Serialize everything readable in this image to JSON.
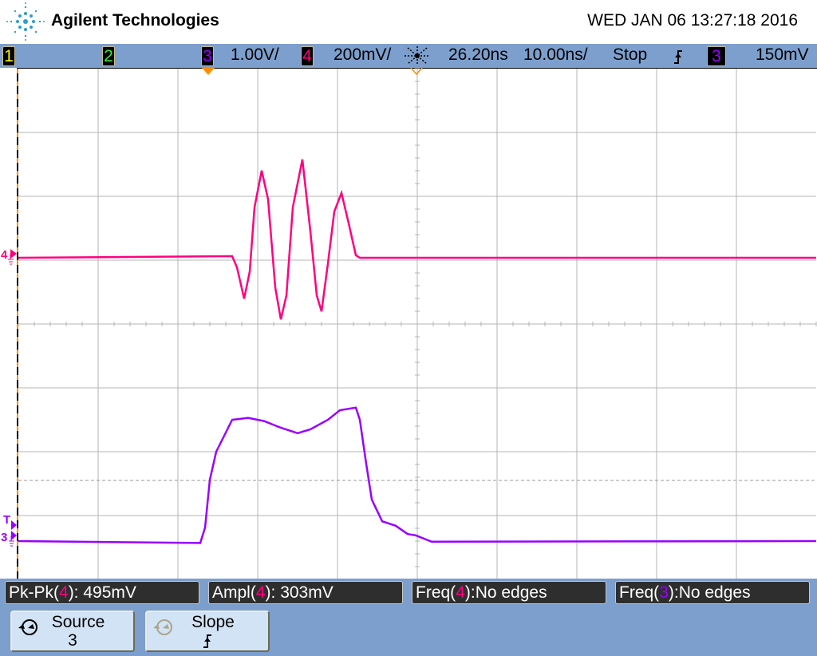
{
  "header": {
    "brand": "Agilent Technologies",
    "datetime": "WED JAN 06 13:27:18 2016"
  },
  "topbar": {
    "channels": [
      {
        "num": "1",
        "color": "#f5f500"
      },
      {
        "num": "2",
        "color": "#33ee33"
      },
      {
        "num": "3",
        "color": "#9900ff",
        "scale": "1.00V/"
      },
      {
        "num": "4",
        "color": "#ff0080",
        "scale": "200mV/"
      }
    ],
    "time_delay": "26.20ns",
    "time_scale": "10.00ns/",
    "run_state": "Stop",
    "trigger_slope_icon": "rising-edge-icon",
    "trigger_source": "3",
    "trigger_level": "150mV"
  },
  "display": {
    "time_per_div_ns": 10,
    "time_center_ns": 26.2,
    "colors": {
      "grid": "#b4b4b4",
      "ch3": "#9900ff",
      "ch4": "#ff0080",
      "marker": "#ff8c00"
    },
    "ch4_markers": {
      "label": "4"
    },
    "ch3_markers": {
      "label": "3",
      "trigger_label": "T"
    },
    "waveforms": {
      "ch4": {
        "units": "mV",
        "per_div": 200,
        "points": [
          [
            -23.8,
            0
          ],
          [
            3.0,
            5
          ],
          [
            3.6,
            -30
          ],
          [
            4.5,
            -128
          ],
          [
            5.2,
            -43
          ],
          [
            5.8,
            158
          ],
          [
            6.7,
            273
          ],
          [
            7.5,
            183
          ],
          [
            8.4,
            -93
          ],
          [
            9.1,
            -193
          ],
          [
            9.8,
            -118
          ],
          [
            10.6,
            158
          ],
          [
            11.8,
            308
          ],
          [
            12.8,
            83
          ],
          [
            13.6,
            -118
          ],
          [
            14.2,
            -168
          ],
          [
            15.0,
            -18
          ],
          [
            15.8,
            145
          ],
          [
            16.7,
            203
          ],
          [
            17.6,
            108
          ],
          [
            18.5,
            8
          ],
          [
            19.0,
            0
          ],
          [
            76.2,
            0
          ]
        ]
      },
      "ch3": {
        "units": "V",
        "per_div": 1,
        "points": [
          [
            -23.8,
            0
          ],
          [
            -1.0,
            -0.03
          ],
          [
            -0.4,
            0.21
          ],
          [
            0.2,
            0.96
          ],
          [
            1.0,
            1.4
          ],
          [
            2.0,
            1.65
          ],
          [
            3.0,
            1.9
          ],
          [
            5.0,
            1.93
          ],
          [
            7.0,
            1.88
          ],
          [
            9.0,
            1.78
          ],
          [
            11.2,
            1.69
          ],
          [
            12.8,
            1.75
          ],
          [
            15.0,
            1.9
          ],
          [
            16.5,
            2.05
          ],
          [
            18.5,
            2.09
          ],
          [
            19.0,
            1.9
          ],
          [
            19.8,
            1.21
          ],
          [
            20.5,
            0.65
          ],
          [
            21.8,
            0.31
          ],
          [
            23.5,
            0.24
          ],
          [
            25.0,
            0.11
          ],
          [
            26.0,
            0.09
          ],
          [
            28.0,
            -0.01
          ],
          [
            76.2,
            0
          ]
        ]
      }
    }
  },
  "measurements": [
    {
      "prefix": "Pk-Pk(",
      "ch": "4",
      "ch_color": "#ff0080",
      "suffix": "): 495mV"
    },
    {
      "prefix": "Ampl(",
      "ch": "4",
      "ch_color": "#ff0080",
      "suffix": "): 303mV"
    },
    {
      "prefix": "Freq(",
      "ch": "4",
      "ch_color": "#ff0080",
      "suffix": "):No edges"
    },
    {
      "prefix": "Freq(",
      "ch": "3",
      "ch_color": "#9900ff",
      "suffix": "):No edges"
    }
  ],
  "softkeys": [
    {
      "label": "Source",
      "value": "3",
      "icon": "rotate-knob-icon"
    },
    {
      "label": "Slope",
      "value": "ʃ",
      "icon": "rotate-knob-icon-disabled"
    }
  ]
}
